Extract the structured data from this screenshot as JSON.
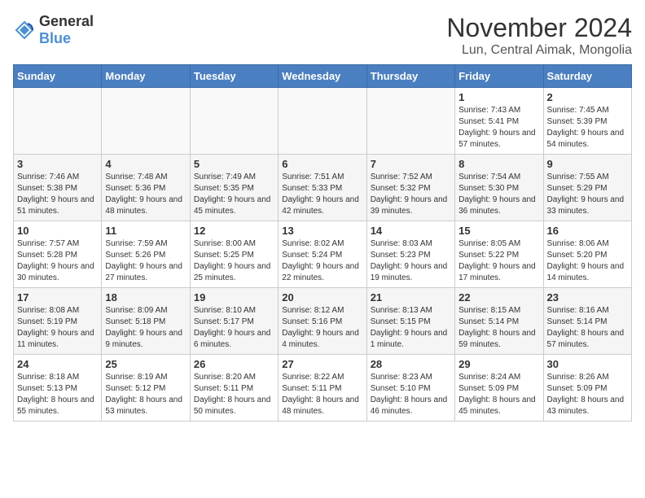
{
  "logo": {
    "general": "General",
    "blue": "Blue"
  },
  "title": "November 2024",
  "location": "Lun, Central Aimak, Mongolia",
  "days_of_week": [
    "Sunday",
    "Monday",
    "Tuesday",
    "Wednesday",
    "Thursday",
    "Friday",
    "Saturday"
  ],
  "weeks": [
    [
      {
        "day": "",
        "info": ""
      },
      {
        "day": "",
        "info": ""
      },
      {
        "day": "",
        "info": ""
      },
      {
        "day": "",
        "info": ""
      },
      {
        "day": "",
        "info": ""
      },
      {
        "day": "1",
        "info": "Sunrise: 7:43 AM\nSunset: 5:41 PM\nDaylight: 9 hours and 57 minutes."
      },
      {
        "day": "2",
        "info": "Sunrise: 7:45 AM\nSunset: 5:39 PM\nDaylight: 9 hours and 54 minutes."
      }
    ],
    [
      {
        "day": "3",
        "info": "Sunrise: 7:46 AM\nSunset: 5:38 PM\nDaylight: 9 hours and 51 minutes."
      },
      {
        "day": "4",
        "info": "Sunrise: 7:48 AM\nSunset: 5:36 PM\nDaylight: 9 hours and 48 minutes."
      },
      {
        "day": "5",
        "info": "Sunrise: 7:49 AM\nSunset: 5:35 PM\nDaylight: 9 hours and 45 minutes."
      },
      {
        "day": "6",
        "info": "Sunrise: 7:51 AM\nSunset: 5:33 PM\nDaylight: 9 hours and 42 minutes."
      },
      {
        "day": "7",
        "info": "Sunrise: 7:52 AM\nSunset: 5:32 PM\nDaylight: 9 hours and 39 minutes."
      },
      {
        "day": "8",
        "info": "Sunrise: 7:54 AM\nSunset: 5:30 PM\nDaylight: 9 hours and 36 minutes."
      },
      {
        "day": "9",
        "info": "Sunrise: 7:55 AM\nSunset: 5:29 PM\nDaylight: 9 hours and 33 minutes."
      }
    ],
    [
      {
        "day": "10",
        "info": "Sunrise: 7:57 AM\nSunset: 5:28 PM\nDaylight: 9 hours and 30 minutes."
      },
      {
        "day": "11",
        "info": "Sunrise: 7:59 AM\nSunset: 5:26 PM\nDaylight: 9 hours and 27 minutes."
      },
      {
        "day": "12",
        "info": "Sunrise: 8:00 AM\nSunset: 5:25 PM\nDaylight: 9 hours and 25 minutes."
      },
      {
        "day": "13",
        "info": "Sunrise: 8:02 AM\nSunset: 5:24 PM\nDaylight: 9 hours and 22 minutes."
      },
      {
        "day": "14",
        "info": "Sunrise: 8:03 AM\nSunset: 5:23 PM\nDaylight: 9 hours and 19 minutes."
      },
      {
        "day": "15",
        "info": "Sunrise: 8:05 AM\nSunset: 5:22 PM\nDaylight: 9 hours and 17 minutes."
      },
      {
        "day": "16",
        "info": "Sunrise: 8:06 AM\nSunset: 5:20 PM\nDaylight: 9 hours and 14 minutes."
      }
    ],
    [
      {
        "day": "17",
        "info": "Sunrise: 8:08 AM\nSunset: 5:19 PM\nDaylight: 9 hours and 11 minutes."
      },
      {
        "day": "18",
        "info": "Sunrise: 8:09 AM\nSunset: 5:18 PM\nDaylight: 9 hours and 9 minutes."
      },
      {
        "day": "19",
        "info": "Sunrise: 8:10 AM\nSunset: 5:17 PM\nDaylight: 9 hours and 6 minutes."
      },
      {
        "day": "20",
        "info": "Sunrise: 8:12 AM\nSunset: 5:16 PM\nDaylight: 9 hours and 4 minutes."
      },
      {
        "day": "21",
        "info": "Sunrise: 8:13 AM\nSunset: 5:15 PM\nDaylight: 9 hours and 1 minute."
      },
      {
        "day": "22",
        "info": "Sunrise: 8:15 AM\nSunset: 5:14 PM\nDaylight: 8 hours and 59 minutes."
      },
      {
        "day": "23",
        "info": "Sunrise: 8:16 AM\nSunset: 5:14 PM\nDaylight: 8 hours and 57 minutes."
      }
    ],
    [
      {
        "day": "24",
        "info": "Sunrise: 8:18 AM\nSunset: 5:13 PM\nDaylight: 8 hours and 55 minutes."
      },
      {
        "day": "25",
        "info": "Sunrise: 8:19 AM\nSunset: 5:12 PM\nDaylight: 8 hours and 53 minutes."
      },
      {
        "day": "26",
        "info": "Sunrise: 8:20 AM\nSunset: 5:11 PM\nDaylight: 8 hours and 50 minutes."
      },
      {
        "day": "27",
        "info": "Sunrise: 8:22 AM\nSunset: 5:11 PM\nDaylight: 8 hours and 48 minutes."
      },
      {
        "day": "28",
        "info": "Sunrise: 8:23 AM\nSunset: 5:10 PM\nDaylight: 8 hours and 46 minutes."
      },
      {
        "day": "29",
        "info": "Sunrise: 8:24 AM\nSunset: 5:09 PM\nDaylight: 8 hours and 45 minutes."
      },
      {
        "day": "30",
        "info": "Sunrise: 8:26 AM\nSunset: 5:09 PM\nDaylight: 8 hours and 43 minutes."
      }
    ]
  ]
}
